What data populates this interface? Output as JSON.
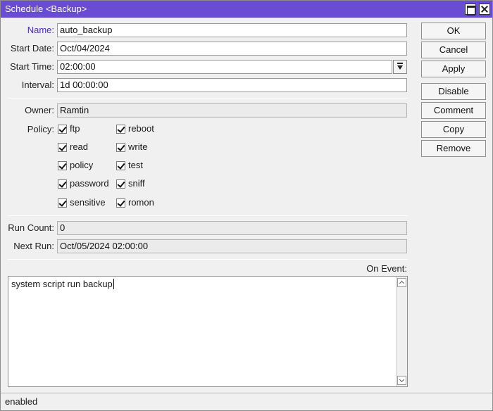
{
  "window": {
    "title": "Schedule <Backup>"
  },
  "form": {
    "name": {
      "label": "Name:",
      "value": "auto_backup"
    },
    "start_date": {
      "label": "Start Date:",
      "value": "Oct/04/2024"
    },
    "start_time": {
      "label": "Start Time:",
      "value": "02:00:00"
    },
    "interval": {
      "label": "Interval:",
      "value": "1d 00:00:00"
    },
    "owner": {
      "label": "Owner:",
      "value": "Ramtin"
    },
    "policy_label": "Policy:",
    "policy": [
      {
        "label": "ftp",
        "checked": true
      },
      {
        "label": "reboot",
        "checked": true
      },
      {
        "label": "read",
        "checked": true
      },
      {
        "label": "write",
        "checked": true
      },
      {
        "label": "policy",
        "checked": true
      },
      {
        "label": "test",
        "checked": true
      },
      {
        "label": "password",
        "checked": true
      },
      {
        "label": "sniff",
        "checked": true
      },
      {
        "label": "sensitive",
        "checked": true
      },
      {
        "label": "romon",
        "checked": true
      }
    ],
    "run_count": {
      "label": "Run Count:",
      "value": "0"
    },
    "next_run": {
      "label": "Next Run:",
      "value": "Oct/05/2024 02:00:00"
    },
    "on_event": {
      "label": "On Event:",
      "value": "system script run backup"
    }
  },
  "buttons": {
    "ok": "OK",
    "cancel": "Cancel",
    "apply": "Apply",
    "disable": "Disable",
    "comment": "Comment",
    "copy": "Copy",
    "remove": "Remove"
  },
  "status": {
    "text": "enabled"
  },
  "colors": {
    "titlebar": "#6a4cd4",
    "highlight_label": "#4b2fc0"
  }
}
